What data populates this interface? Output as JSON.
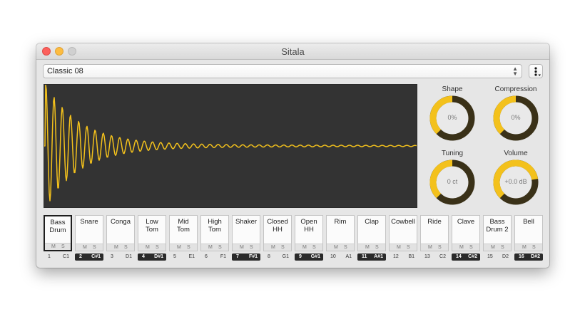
{
  "window": {
    "title": "Sitala"
  },
  "preset": {
    "name": "Classic 08"
  },
  "colors": {
    "accent": "#f3c11c",
    "waveform_bg": "#333333",
    "knob_track": "#3a3118"
  },
  "knobs": [
    {
      "label": "Shape",
      "value": "0%",
      "level": 0.5
    },
    {
      "label": "Compression",
      "value": "0%",
      "level": 0.5
    },
    {
      "label": "Tuning",
      "value": "0 ct",
      "level": 0.5
    },
    {
      "label": "Volume",
      "value": "+0.0 dB",
      "level": 0.8
    }
  ],
  "pads": [
    {
      "name": "Bass\nDrum",
      "m": "M",
      "s": "S",
      "number": "1",
      "note": "C1",
      "selected": true,
      "dark": false
    },
    {
      "name": "Snare",
      "m": "M",
      "s": "S",
      "number": "2",
      "note": "C#1",
      "selected": false,
      "dark": true
    },
    {
      "name": "Conga",
      "m": "M",
      "s": "S",
      "number": "3",
      "note": "D1",
      "selected": false,
      "dark": false
    },
    {
      "name": "Low\nTom",
      "m": "M",
      "s": "S",
      "number": "4",
      "note": "D#1",
      "selected": false,
      "dark": true
    },
    {
      "name": "Mid\nTom",
      "m": "M",
      "s": "S",
      "number": "5",
      "note": "E1",
      "selected": false,
      "dark": false
    },
    {
      "name": "High\nTom",
      "m": "M",
      "s": "S",
      "number": "6",
      "note": "F1",
      "selected": false,
      "dark": false
    },
    {
      "name": "Shaker",
      "m": "M",
      "s": "S",
      "number": "7",
      "note": "F#1",
      "selected": false,
      "dark": true
    },
    {
      "name": "Closed\nHH",
      "m": "M",
      "s": "S",
      "number": "8",
      "note": "G1",
      "selected": false,
      "dark": false
    },
    {
      "name": "Open\nHH",
      "m": "M",
      "s": "S",
      "number": "9",
      "note": "G#1",
      "selected": false,
      "dark": true
    },
    {
      "name": "Rim",
      "m": "M",
      "s": "S",
      "number": "10",
      "note": "A1",
      "selected": false,
      "dark": false
    },
    {
      "name": "Clap",
      "m": "M",
      "s": "S",
      "number": "11",
      "note": "A#1",
      "selected": false,
      "dark": true
    },
    {
      "name": "Cowbell",
      "m": "M",
      "s": "S",
      "number": "12",
      "note": "B1",
      "selected": false,
      "dark": false
    },
    {
      "name": "Ride",
      "m": "M",
      "s": "S",
      "number": "13",
      "note": "C2",
      "selected": false,
      "dark": false
    },
    {
      "name": "Clave",
      "m": "M",
      "s": "S",
      "number": "14",
      "note": "C#2",
      "selected": false,
      "dark": true
    },
    {
      "name": "Bass\nDrum 2",
      "m": "M",
      "s": "S",
      "number": "15",
      "note": "D2",
      "selected": false,
      "dark": false
    },
    {
      "name": "Bell",
      "m": "M",
      "s": "S",
      "number": "16",
      "note": "D#2",
      "selected": false,
      "dark": true
    }
  ]
}
